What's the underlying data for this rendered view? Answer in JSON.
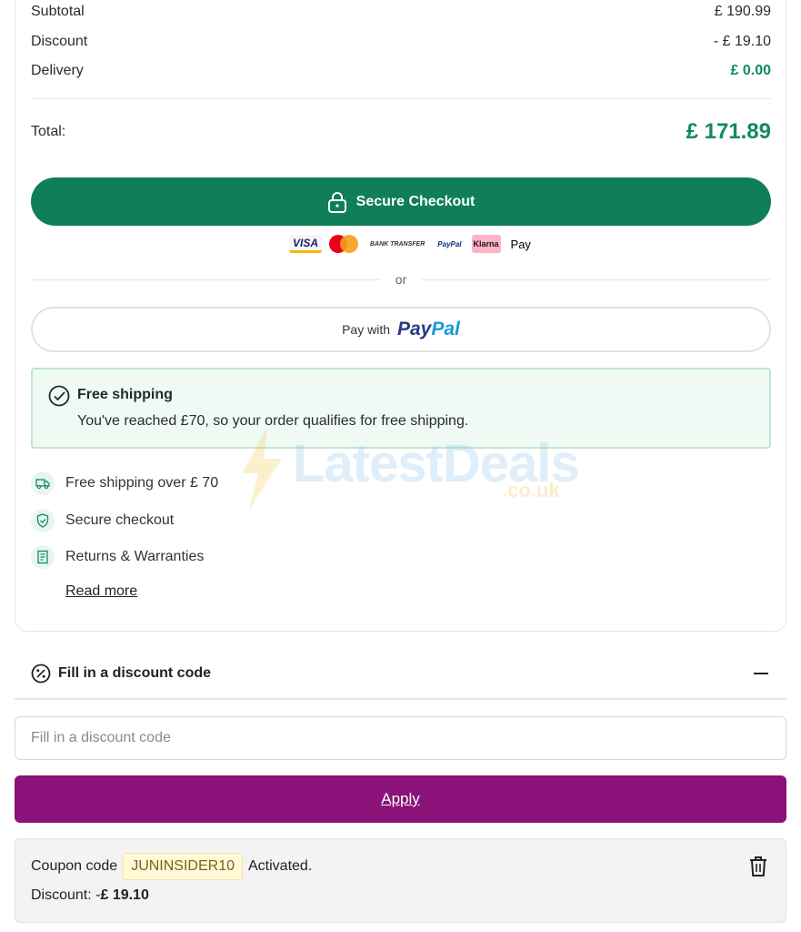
{
  "summary": {
    "subtotal_label": "Subtotal",
    "subtotal_value": "£ 190.99",
    "discount_label": "Discount",
    "discount_value": "- £ 19.10",
    "delivery_label": "Delivery",
    "delivery_value": "£ 0.00",
    "total_label": "Total:",
    "total_value": "£ 171.89"
  },
  "checkout": {
    "button_label": "Secure Checkout",
    "payment_methods": [
      "VISA",
      "mastercard",
      "BANK TRANSFER",
      "PayPal",
      "Klarna",
      "Pay"
    ],
    "or_label": "or",
    "paypal_prefix": "Pay with",
    "paypal_pay": "Pay",
    "paypal_pal": "Pal"
  },
  "free_shipping": {
    "title": "Free shipping",
    "text": "You've reached £70, so your order qualifies for free shipping."
  },
  "benefits": [
    {
      "label": "Free shipping over £ 70",
      "icon": "truck-icon"
    },
    {
      "label": "Secure checkout",
      "icon": "shield-check-icon"
    },
    {
      "label": "Returns & Warranties",
      "icon": "receipt-icon"
    }
  ],
  "read_more": "Read more",
  "watermark": {
    "text": "LatestDeals",
    "sub": ".co.uk"
  },
  "discount": {
    "header_title": "Fill in a discount code",
    "input_placeholder": "Fill in a discount code",
    "input_value": "",
    "apply_label": "Apply"
  },
  "coupon": {
    "prefix": "Coupon code",
    "code": "JUNINSIDER10",
    "status": "Activated.",
    "discount_prefix": "Discount: -",
    "discount_value": "£ 19.10"
  },
  "colors": {
    "accent_green": "#0f7f58",
    "apply_purple": "#8a1278",
    "free_ship_bg": "#eefaf3"
  }
}
